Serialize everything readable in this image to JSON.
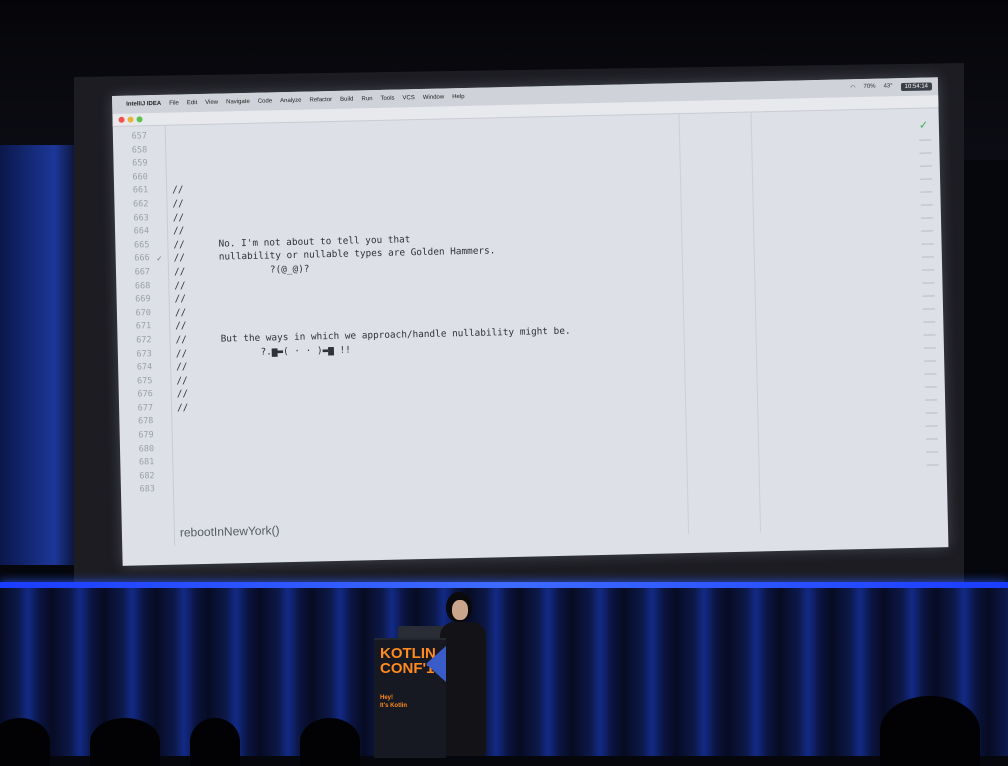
{
  "menubar": {
    "app": "IntelliJ IDEA",
    "items": [
      "File",
      "Edit",
      "View",
      "Navigate",
      "Code",
      "Analyze",
      "Refactor",
      "Build",
      "Run",
      "Tools",
      "VCS",
      "Window",
      "Help"
    ],
    "battery": "70%",
    "temperature": "43°",
    "clock": "10:54:14"
  },
  "editor": {
    "line_numbers": [
      "657",
      "658",
      "659",
      "660",
      "661",
      "662",
      "663",
      "664",
      "665",
      "666",
      "667",
      "668",
      "669",
      "670",
      "671",
      "672",
      "673",
      "674",
      "675",
      "676",
      "677",
      "678",
      "679",
      "680",
      "681",
      "682",
      "683"
    ],
    "lines": [
      "",
      "",
      "",
      "",
      "//",
      "//",
      "//",
      "//",
      "//      No. I'm not about to tell you that",
      "//      nullability or nullable types are Golden Hammers.",
      "//               ?(@_@)?",
      "//",
      "//",
      "//",
      "//",
      "//      But the ways in which we approach/handle nullability might be.",
      "//             ?.▆▬( · · )▬▆ !!",
      "//",
      "//",
      "//",
      "//",
      "",
      "",
      "",
      "",
      "",
      ""
    ],
    "breadcrumb": "rebootInNewYork()"
  },
  "podium": {
    "brand_line1": "KOTLIN",
    "brand_line2": "CONF'19",
    "tagline_line1": "Hey!",
    "tagline_line2": "It's Kotlin"
  }
}
